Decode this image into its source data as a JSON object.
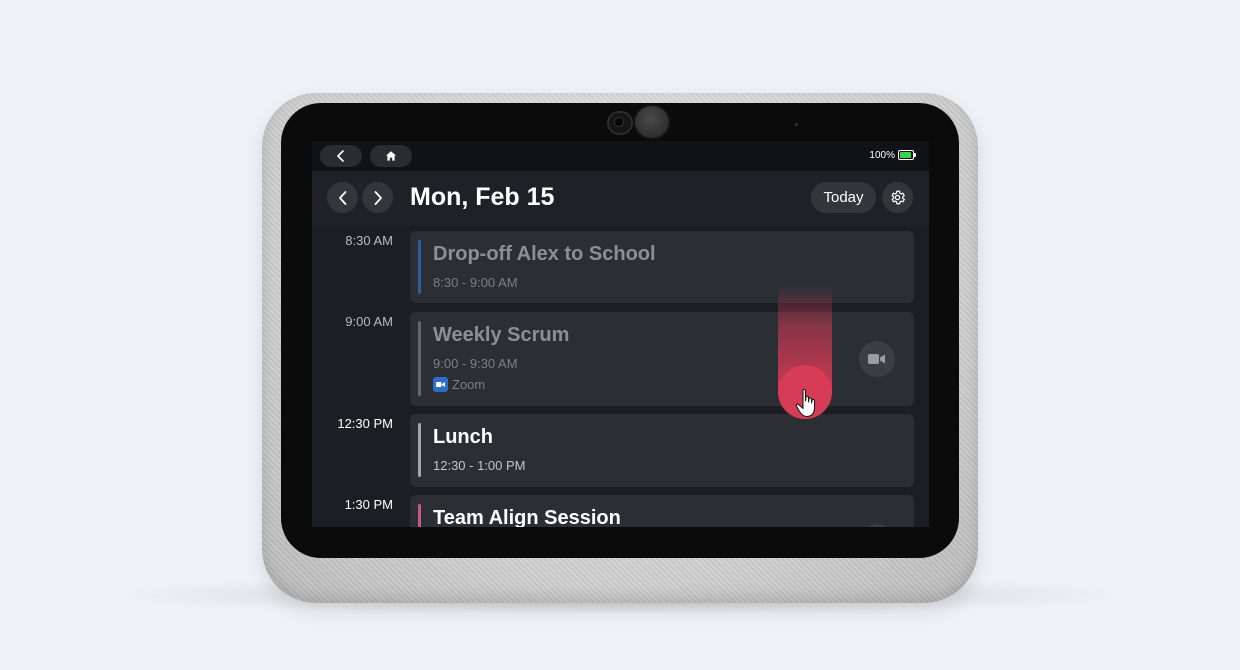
{
  "statusbar": {
    "battery_text": "100%",
    "battery_level": 1.0,
    "battery_color": "#3fd14a"
  },
  "header": {
    "date": "Mon, Feb 15",
    "today_label": "Today"
  },
  "events": [
    {
      "time": "8:30 AM",
      "title": "Drop-off Alex to School",
      "range": "8:30 - 9:00 AM",
      "bar_color": "#2b5f9c",
      "state": "past"
    },
    {
      "time": "9:00 AM",
      "title": "Weekly Scrum",
      "range": "9:00 - 9:30 AM",
      "location": "Zoom",
      "bar_color": "#63666b",
      "state": "past",
      "has_video": true
    },
    {
      "time": "12:30 PM",
      "title": "Lunch",
      "range": "12:30 - 1:00 PM",
      "bar_color": "#a3a6ab",
      "state": "upcoming"
    },
    {
      "time": "1:30 PM",
      "title": "Team Align Session",
      "bar_color": "#c65a84",
      "state": "upcoming"
    }
  ],
  "colors": {
    "accent_touch": "#d63c56",
    "screen_bg": "#1c1e23",
    "card_bg": "#2b2e33",
    "zoom_blue": "#2d6ec9"
  },
  "icons": [
    "back-icon",
    "home-icon",
    "battery-icon",
    "chevron-left-icon",
    "chevron-right-icon",
    "gear-icon",
    "video-camera-icon",
    "zoom-icon",
    "hand-pointer-icon"
  ]
}
